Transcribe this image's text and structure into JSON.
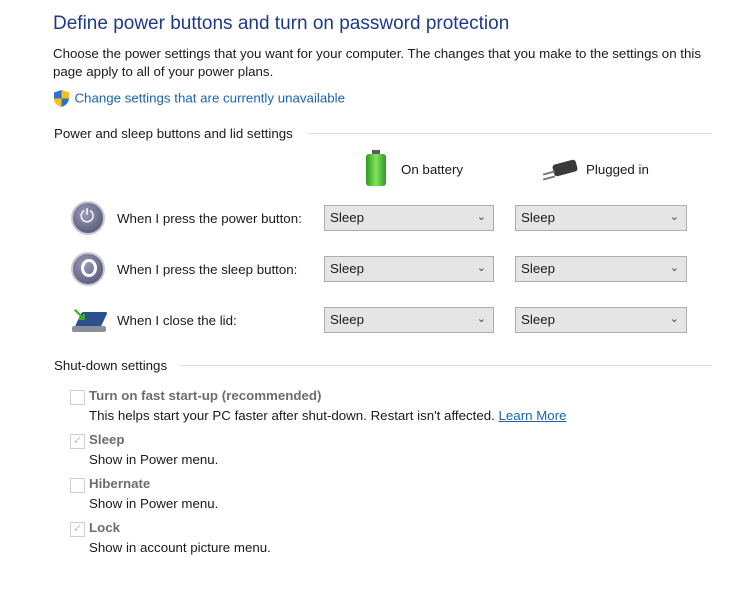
{
  "title": "Define power buttons and turn on password protection",
  "description": "Choose the power settings that you want for your computer. The changes that you make to the settings on this page apply to all of your power plans.",
  "change_link": "Change settings that are currently unavailable",
  "power_section": {
    "header": "Power and sleep buttons and lid settings",
    "columns": {
      "battery": "On battery",
      "plugged": "Plugged in"
    },
    "rows": [
      {
        "label": "When I press the power button:",
        "icon": "power-button-icon",
        "battery": "Sleep",
        "plugged": "Sleep"
      },
      {
        "label": "When I press the sleep button:",
        "icon": "sleep-button-icon",
        "battery": "Sleep",
        "plugged": "Sleep"
      },
      {
        "label": "When I close the lid:",
        "icon": "laptop-lid-icon",
        "battery": "Sleep",
        "plugged": "Sleep"
      }
    ]
  },
  "shutdown_section": {
    "header": "Shut-down settings",
    "items": [
      {
        "label": "Turn on fast start-up (recommended)",
        "checked": false,
        "desc": "This helps start your PC faster after shut-down. Restart isn't affected.",
        "link": "Learn More"
      },
      {
        "label": "Sleep",
        "checked": true,
        "desc": "Show in Power menu."
      },
      {
        "label": "Hibernate",
        "checked": false,
        "desc": "Show in Power menu."
      },
      {
        "label": "Lock",
        "checked": true,
        "desc": "Show in account picture menu."
      }
    ]
  }
}
